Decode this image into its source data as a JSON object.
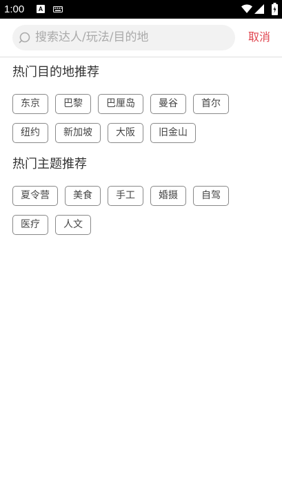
{
  "status_bar": {
    "time": "1:00",
    "icons": [
      "a-icon",
      "keyboard-icon",
      "wifi-icon",
      "signal-icon",
      "battery-icon"
    ]
  },
  "search": {
    "placeholder": "搜索达人/玩法/目的地",
    "cancel_label": "取消"
  },
  "colors": {
    "accent": "#e0454f",
    "tag_border": "#888888",
    "search_bg": "#f2f2f2"
  },
  "sections": [
    {
      "title": "热门目的地推荐",
      "tags": [
        "东京",
        "巴黎",
        "巴厘岛",
        "曼谷",
        "首尔",
        "纽约",
        "新加坡",
        "大阪",
        "旧金山"
      ]
    },
    {
      "title": "热门主题推荐",
      "tags": [
        "夏令营",
        "美食",
        "手工",
        "婚摄",
        "自驾",
        "医疗",
        "人文"
      ]
    }
  ]
}
